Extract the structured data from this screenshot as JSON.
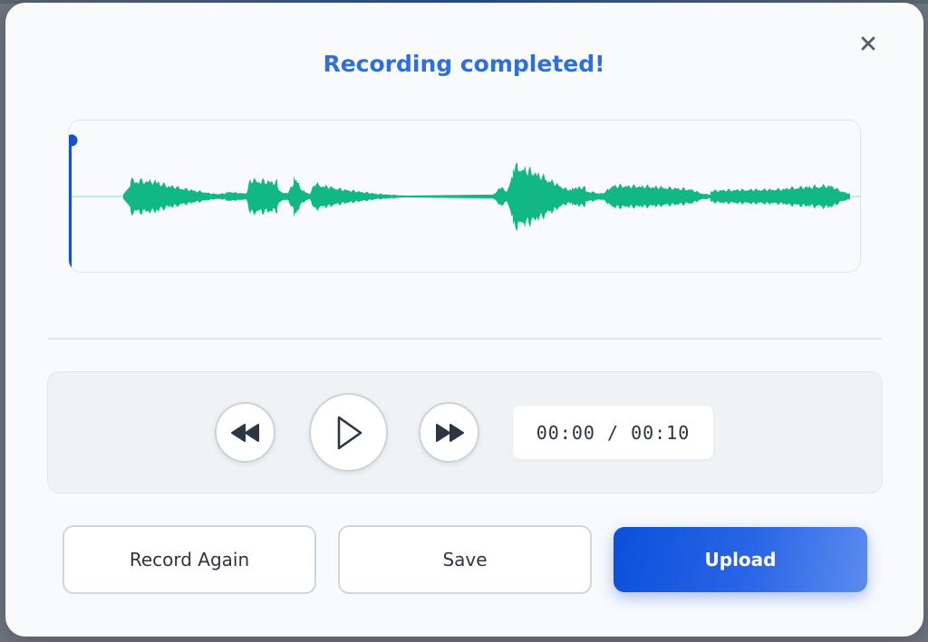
{
  "dialog": {
    "title": "Recording completed!",
    "close_icon": "close-icon"
  },
  "waveform": {
    "color": "#12b881",
    "playhead_color": "#1750c9",
    "playhead_position": 0
  },
  "player": {
    "rewind_icon": "rewind-icon",
    "play_icon": "play-icon",
    "forward_icon": "fast-forward-icon",
    "current_time": "00:00",
    "separator": " / ",
    "total_time": "00:10"
  },
  "actions": {
    "record_again_label": "Record Again",
    "save_label": "Save",
    "upload_label": "Upload"
  },
  "colors": {
    "accent": "#2f6fd8",
    "primary_button": "#0b4fdb"
  }
}
